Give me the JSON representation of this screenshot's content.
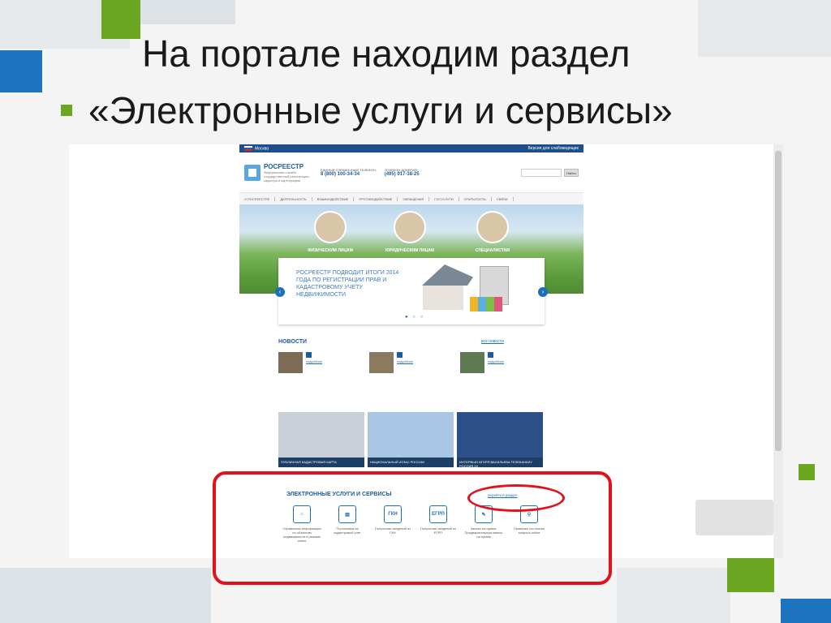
{
  "slide": {
    "title_line": "На портале находим раздел",
    "bullet_text": "«Электронные услуги и сервисы»"
  },
  "site": {
    "topbar_left": "Москва",
    "topbar_right": "Версия для слабовидящих",
    "logo_name": "РОСРЕЕСТР",
    "logo_subtitle": "Федеральная служба государственной регистрации, кадастра и картографии",
    "phone_label": "ЕДИНЫЙ СПРАВОЧНЫЙ ТЕЛЕФОН:",
    "phone_number": "8 (800) 100-34-34",
    "trust_label": "ТЕЛЕФОН ДОВЕРИЯ:",
    "trust_number": "(495) 917-38-25",
    "search_button": "Найти",
    "nav": [
      "О РОСРЕЕСТРЕ",
      "ДЕЯТЕЛЬНОСТЬ",
      "ВЗАИМОДЕЙСТВИЕ",
      "ПРОТИВОДЕЙСТВИЕ",
      "ОБРАЩЕНИЯ",
      "ГОСУСЛУГИ",
      "ОТКРЫТОСТЬ",
      "СВЯЗИ"
    ],
    "audience": [
      "ФИЗИЧЕСКИМ ЛИЦАМ",
      "ЮРИДИЧЕСКИМ ЛИЦАМ",
      "СПЕЦИАЛИСТАМ"
    ],
    "promo_text": "РОСРЕЕСТР ПОДВОДИТ ИТОГИ 2014 ГОДА ПО РЕГИСТРАЦИИ ПРАВ И КАДАСТРОВОМУ УЧЕТУ НЕДВИЖИМОСТИ",
    "news_title": "НОВОСТИ",
    "news_all": "все новости",
    "news_more": "подробнее",
    "tiles": [
      "ПУБЛИЧНАЯ КАДАСТРОВАЯ КАРТА",
      "НАЦИОНАЛЬНЫЙ АТЛАС РОССИИ",
      "ИНТЕРВЬЮ ИГОРЯ ВАСИЛЬЕВА ТЕЛЕКАНАЛУ РОССИЯ 24"
    ],
    "services_title": "ЭЛЕКТРОННЫЕ УСЛУГИ И СЕРВИСЫ",
    "services_all": "перейти в раздел",
    "services": [
      {
        "icon": "house-icon",
        "glyph": "⌂",
        "label": "Справочная информация по объектам недвижимости в режиме online"
      },
      {
        "icon": "book-icon",
        "glyph": "▤",
        "label": "Постановка на кадастровый учет"
      },
      {
        "icon": "gkn-icon",
        "glyph": "ГКН",
        "label": "Получение сведений из ГКН"
      },
      {
        "icon": "egrp-icon",
        "glyph": "ЕГРП",
        "label": "Получение сведений из ЕГРП"
      },
      {
        "icon": "pen-icon",
        "glyph": "✎",
        "label": "Запись на прием. Предварительная запись на прием"
      },
      {
        "icon": "magnifier-icon",
        "glyph": "⚲",
        "label": "Проверка состояния запроса online"
      }
    ]
  },
  "colors": {
    "annotation_red": "#e3121a",
    "accent_green": "#6aa61f",
    "accent_blue": "#1e6fb9"
  }
}
